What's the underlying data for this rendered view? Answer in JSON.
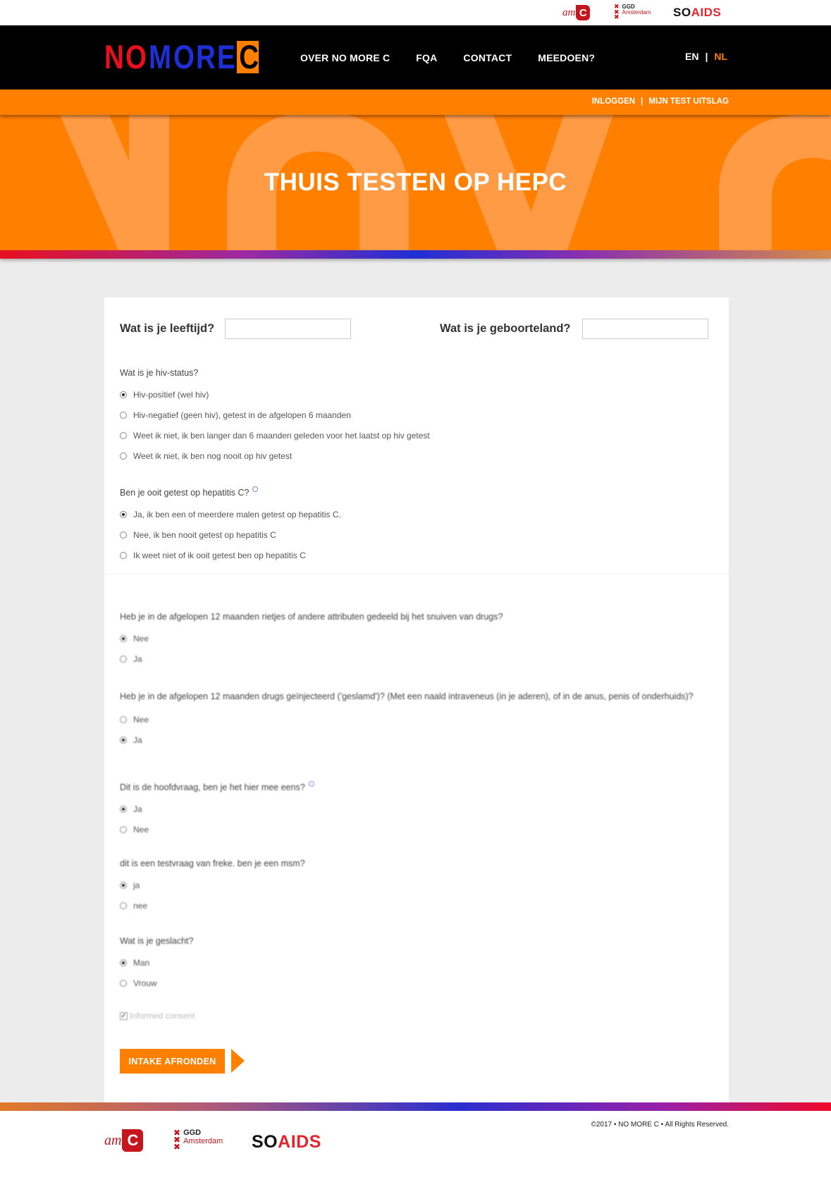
{
  "partners": {
    "amc": {
      "am": "am",
      "c": "C"
    },
    "ggd": {
      "line1": "GGD",
      "line2": "Amsterdam"
    },
    "soaids": {
      "soa": "SOA",
      "aids": "IDS"
    }
  },
  "brand": {
    "letters": [
      "N",
      "O",
      "M",
      "O",
      "R",
      "E",
      "C"
    ]
  },
  "nav": {
    "items": [
      "OVER NO MORE C",
      "FQA",
      "CONTACT",
      "MEEDOEN?"
    ],
    "lang_en": "EN",
    "lang_sep": "|",
    "lang_nl": "NL"
  },
  "subnav": {
    "login": "INLOGGEN",
    "sep": "|",
    "results": "MIJN TEST UITSLAG"
  },
  "hero": {
    "title": "THUIS TESTEN OP HEPC"
  },
  "form": {
    "age_label": "Wat is je leeftijd?",
    "age_value": "",
    "country_label": "Wat is je geboorteland?",
    "country_value": "",
    "questions": [
      {
        "title": "Wat is je hiv-status?",
        "options": [
          {
            "label": "Hiv-positief (wel hiv)",
            "checked": true
          },
          {
            "label": "Hiv-negatief (geen hiv), getest in de afgelopen 6 maanden",
            "checked": false
          },
          {
            "label": "Weet ik niet, ik ben langer dan 6 maanden geleden voor het laatst op hiv getest",
            "checked": false
          },
          {
            "label": "Weet ik niet, ik ben nog nooit op hiv getest",
            "checked": false
          }
        ]
      },
      {
        "title": "Ben je ooit getest op hepatitis C?",
        "options": [
          {
            "label": "Ja, ik ben een of meerdere malen getest op hepatitis C.",
            "checked": true
          },
          {
            "label": "Nee, ik ben nooit getest op hepatitis C",
            "checked": false
          },
          {
            "label": "Ik weet niet of ik ooit getest ben op hepatitis C",
            "checked": false
          }
        ]
      },
      {
        "title": "Heb je in de afgelopen 12 maanden rietjes of andere attributen gedeeld bij het snuiven van drugs?",
        "options": [
          {
            "label": "Nee",
            "checked": true
          },
          {
            "label": "Ja",
            "checked": false
          }
        ]
      },
      {
        "title": "Heb je in de afgelopen 12 maanden drugs geïnjecteerd ('geslamd')? (Met een naald intraveneus (in je aderen), of in de anus, penis of onderhuids)?",
        "options": [
          {
            "label": "Nee",
            "checked": false
          },
          {
            "label": "Ja",
            "checked": true
          }
        ]
      },
      {
        "title": "Dit is de hoofdvraag, ben je het hier mee eens?",
        "options": [
          {
            "label": "Ja",
            "checked": true
          },
          {
            "label": "Nee",
            "checked": false
          }
        ]
      },
      {
        "title": "dit is een testvraag van freke. ben je een msm?",
        "options": [
          {
            "label": "ja",
            "checked": true
          },
          {
            "label": "nee",
            "checked": false
          }
        ]
      },
      {
        "title": "Wat is je geslacht?",
        "options": [
          {
            "label": "Man",
            "checked": true
          },
          {
            "label": "Vrouw",
            "checked": false
          }
        ]
      }
    ],
    "consent_label": "Informed consent",
    "consent_checked": true,
    "submit_label": "INTAKE AFRONDEN"
  },
  "footer": {
    "copyright": "©2017 • NO MORE C • All Rights Reserved."
  },
  "colors": {
    "orange": "#ff7f00",
    "black": "#000000",
    "red": "#e1262d",
    "blue": "#1f2fd6"
  }
}
